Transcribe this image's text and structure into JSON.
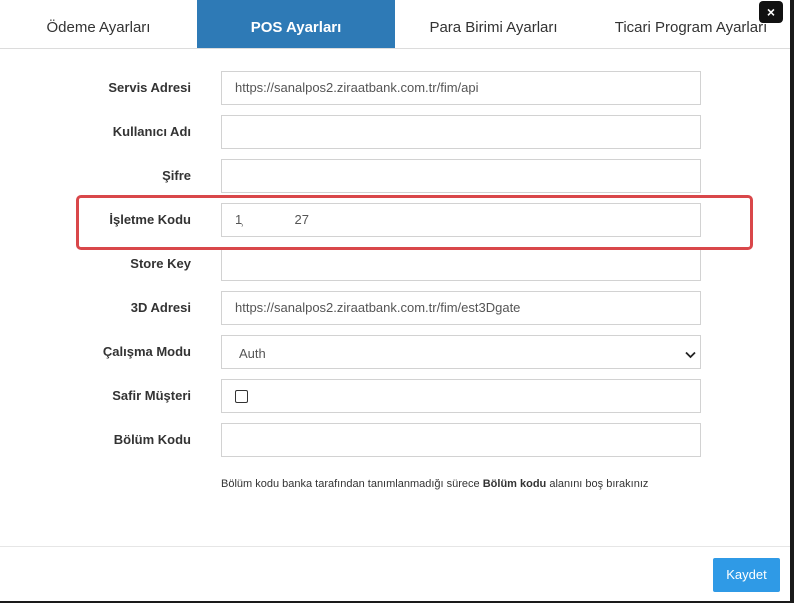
{
  "tabs": [
    {
      "label": "Ödeme Ayarları",
      "active": false
    },
    {
      "label": "POS Ayarları",
      "active": true
    },
    {
      "label": "Para Birimi Ayarları",
      "active": false
    },
    {
      "label": "Ticari Program Ayarları",
      "active": false
    }
  ],
  "close_label": "×",
  "form": {
    "servis_adresi": {
      "label": "Servis Adresi",
      "value": "https://sanalpos2.ziraatbank.com.tr/fim/api"
    },
    "kullanici_adi": {
      "label": "Kullanıcı Adı",
      "value": ""
    },
    "sifre": {
      "label": "Şifre",
      "value": ""
    },
    "isletme_kodu": {
      "label": "İşletme Kodu",
      "value_start": "1̹",
      "value_end": "27"
    },
    "store_key": {
      "label": "Store Key",
      "value": ""
    },
    "adres_3d": {
      "label": "3D Adresi",
      "value": "https://sanalpos2.ziraatbank.com.tr/fim/est3Dgate"
    },
    "calisma_modu": {
      "label": "Çalışma Modu",
      "selected": "Auth"
    },
    "safir_musteri": {
      "label": "Safir Müşteri",
      "checked": false
    },
    "bolum_kodu": {
      "label": "Bölüm Kodu",
      "value": ""
    }
  },
  "hint": {
    "before": "Bölüm kodu banka tarafından tanımlanmadığı sürece ",
    "bold": "Bölüm kodu",
    "after": " alanını boş bırakınız"
  },
  "save_label": "Kaydet",
  "colors": {
    "active_tab": "#2e7ab6",
    "save_button": "#2f9ae6",
    "highlight": "#d9474a"
  }
}
